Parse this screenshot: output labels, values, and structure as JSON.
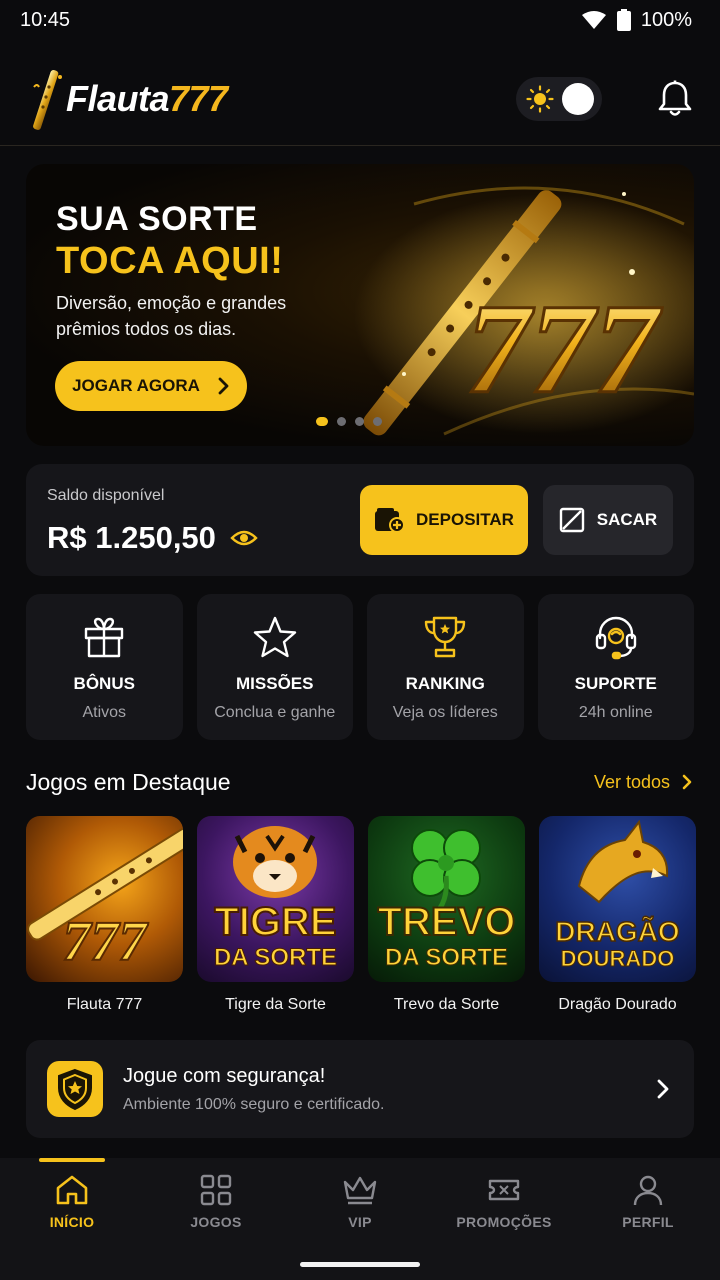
{
  "status_bar": {
    "time": "10:45",
    "battery": "100%"
  },
  "header": {
    "logo_white": "Flauta",
    "logo_gold": "777"
  },
  "hero": {
    "title_line1": "SUA SORTE",
    "title_line2": "TOCA AQUI!",
    "subtitle": "Diversão, emoção e grandes prêmios todos os dias.",
    "cta_label": "JOGAR AGORA",
    "art_text": "777",
    "slides": 4,
    "active_slide": 1
  },
  "balance": {
    "label": "Saldo disponível",
    "value": "R$ 1.250,50",
    "deposit_label": "DEPOSITAR",
    "withdraw_label": "SACAR"
  },
  "quick_actions": [
    {
      "title": "BÔNUS",
      "subtitle": "Ativos",
      "icon": "gift-icon"
    },
    {
      "title": "MISSÕES",
      "subtitle": "Conclua e ganhe",
      "icon": "star-icon"
    },
    {
      "title": "RANKING",
      "subtitle": "Veja os líderes",
      "icon": "trophy-icon"
    },
    {
      "title": "SUPORTE",
      "subtitle": "24h online",
      "icon": "headset-icon"
    }
  ],
  "featured": {
    "title": "Jogos em Destaque",
    "see_all": "Ver todos",
    "games": [
      {
        "name": "Flauta 777",
        "thumb_line1": "777",
        "thumb_line2": ""
      },
      {
        "name": "Tigre da Sorte",
        "thumb_line1": "TIGRE",
        "thumb_line2": "DA SORTE"
      },
      {
        "name": "Trevo da Sorte",
        "thumb_line1": "TREVO",
        "thumb_line2": "DA SORTE"
      },
      {
        "name": "Dragão Dourado",
        "thumb_line1": "DRAGÃO",
        "thumb_line2": "DOURADO"
      }
    ]
  },
  "security": {
    "title": "Jogue com segurança!",
    "subtitle": "Ambiente 100% seguro e certificado."
  },
  "bottom_nav": [
    {
      "label": "INÍCIO",
      "icon": "home-icon",
      "active": true
    },
    {
      "label": "JOGOS",
      "icon": "grid-icon",
      "active": false
    },
    {
      "label": "VIP",
      "icon": "crown-icon",
      "active": false
    },
    {
      "label": "PROMOÇÕES",
      "icon": "ticket-icon",
      "active": false
    },
    {
      "label": "PERFIL",
      "icon": "user-icon",
      "active": false
    }
  ],
  "colors": {
    "accent": "#f6c21c",
    "background": "#0b0b0d",
    "card": "#16161a"
  }
}
